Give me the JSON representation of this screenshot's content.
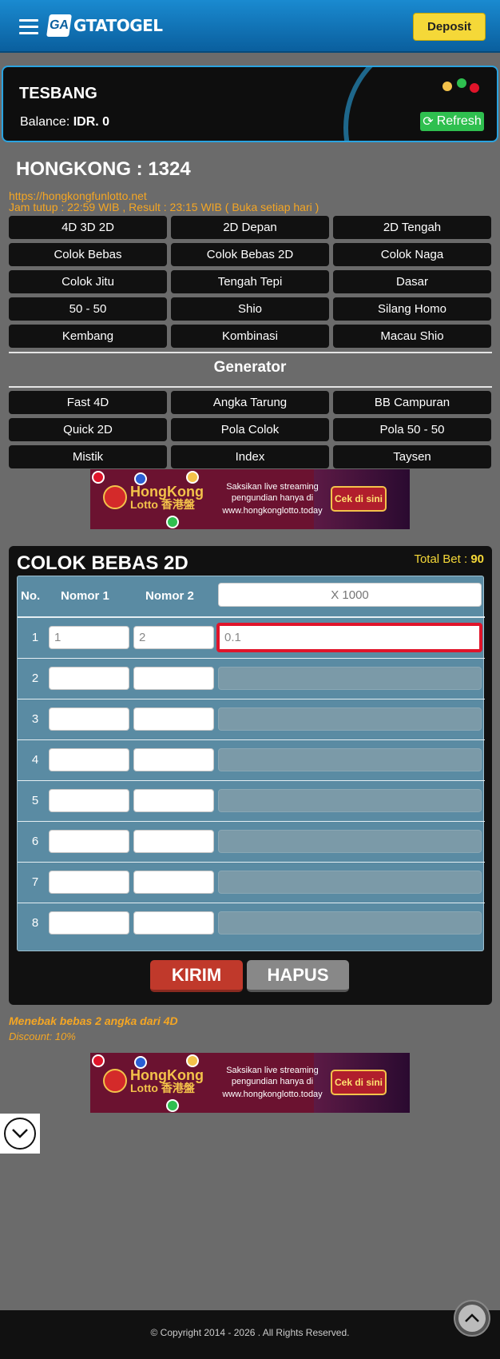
{
  "header": {
    "logo_badge": "GA",
    "logo_text": "GTATOGEL",
    "deposit_label": "Deposit"
  },
  "account": {
    "username": "TESBANG",
    "balance_label": "Balance:",
    "balance_value": "IDR. 0",
    "refresh_label": "Refresh"
  },
  "market": {
    "title": "HONGKONG : 1324",
    "url": "https://hongkongfunlotto.net",
    "schedule": "Jam tutup : 22:59 WIB , Result : 23:15 WIB ( Buka setiap hari )"
  },
  "game_types": [
    "4D 3D 2D",
    "2D Depan",
    "2D Tengah",
    "Colok Bebas",
    "Colok Bebas 2D",
    "Colok Naga",
    "Colok Jitu",
    "Tengah Tepi",
    "Dasar",
    "50 - 50",
    "Shio",
    "Silang Homo",
    "Kembang",
    "Kombinasi",
    "Macau Shio"
  ],
  "generator": {
    "title": "Generator",
    "items": [
      "Fast 4D",
      "Angka Tarung",
      "BB Campuran",
      "Quick 2D",
      "Pola Colok",
      "Pola 50 - 50",
      "Mistik",
      "Index",
      "Taysen"
    ]
  },
  "ad": {
    "brand_line1": "HongKong",
    "brand_line2": "Lotto 香港盤",
    "live_text": "Saksikan live streaming pengundian hanya di",
    "site": "www.hongkonglotto.today",
    "cta": "Cek di sini"
  },
  "bet_panel": {
    "title": "COLOK BEBAS 2D",
    "total_bet_label": "Total Bet :",
    "total_bet_value": "90",
    "col_no": "No.",
    "col_n1": "Nomor 1",
    "col_n2": "Nomor 2",
    "multiplier_placeholder": "X 1000",
    "rows": [
      {
        "no": "1",
        "n1": "1",
        "n2": "2",
        "amount": "0.1"
      },
      {
        "no": "2",
        "n1": "",
        "n2": "",
        "amount": ""
      },
      {
        "no": "3",
        "n1": "",
        "n2": "",
        "amount": ""
      },
      {
        "no": "4",
        "n1": "",
        "n2": "",
        "amount": ""
      },
      {
        "no": "5",
        "n1": "",
        "n2": "",
        "amount": ""
      },
      {
        "no": "6",
        "n1": "",
        "n2": "",
        "amount": ""
      },
      {
        "no": "7",
        "n1": "",
        "n2": "",
        "amount": ""
      },
      {
        "no": "8",
        "n1": "",
        "n2": "",
        "amount": ""
      }
    ],
    "submit_label": "KIRIM",
    "clear_label": "HAPUS"
  },
  "info": {
    "description": "Menebak bebas 2 angka dari 4D",
    "discount": "Discount: 10%"
  },
  "footer": {
    "copyright": "© Copyright 2014 - 2026 . All Rights Reserved."
  },
  "colors": {
    "header_blue": "#0a5f9e",
    "deposit_yellow": "#f5d838",
    "refresh_green": "#2fbf4f",
    "accent_orange": "#f5a623",
    "table_blue": "#5a8ba3",
    "kirim_red": "#c0392b",
    "highlight_red": "#e0142a"
  }
}
